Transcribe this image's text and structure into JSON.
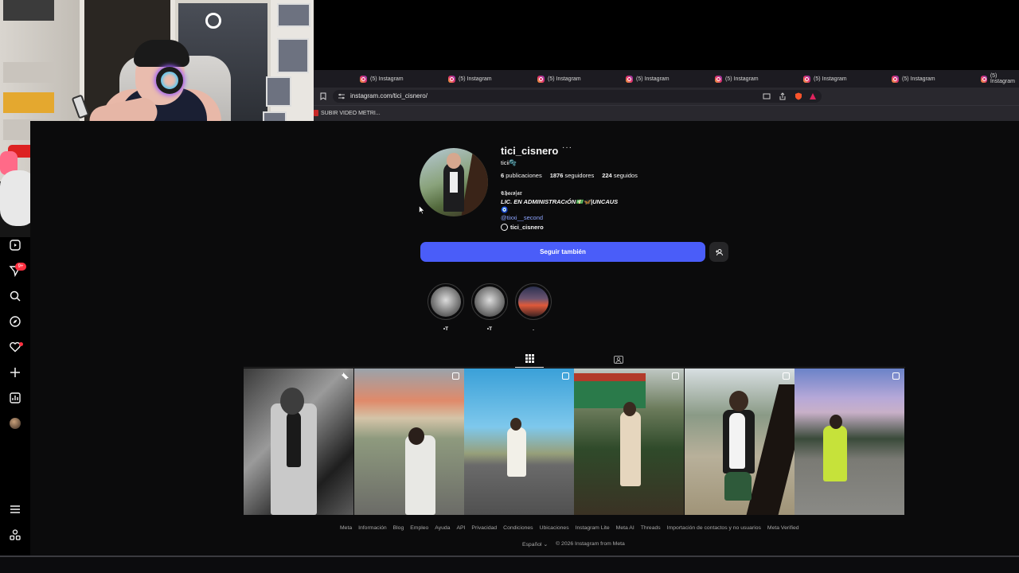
{
  "browser": {
    "tab_title": "(5) Instagram",
    "tab_count": 8,
    "url": "instagram.com/tici_cisnero/",
    "bookmark": "SUBIR VIDEO METRI..."
  },
  "sidebar": {
    "notification_badge": "9+",
    "items": [
      "reels-icon",
      "messages-icon",
      "search-icon",
      "explore-icon",
      "notifications-icon",
      "create-icon",
      "dashboard-icon",
      "profile-avatar",
      "menu-icon",
      "more-icon"
    ]
  },
  "profile": {
    "username": "tici_cisnero",
    "more": "···",
    "fullname": "ticii🫧",
    "posts_count": "6",
    "posts_label": "publicaciones",
    "followers_count": "1876",
    "followers_label": "seguidores",
    "following_count": "224",
    "following_label": "seguidos",
    "bio": [
      "𝕮𝖍𝖆𝖈𝖔|𝖆𝖗",
      "LIC. EN ADMINISTRACıÓN💵🦋|UNCAUS",
      "🧿",
      "@tixxi__second"
    ],
    "threads": "tici_cisnero",
    "follow_button": "Seguir también"
  },
  "highlights": [
    {
      "label": "•T"
    },
    {
      "label": "•T"
    },
    {
      "label": "."
    }
  ],
  "tabs": [
    "posts-grid-tab",
    "tagged-tab"
  ],
  "footer": {
    "links": [
      "Meta",
      "Información",
      "Blog",
      "Empleo",
      "Ayuda",
      "API",
      "Privacidad",
      "Condiciones",
      "Ubicaciones",
      "Instagram Lite",
      "Meta AI",
      "Threads",
      "Importación de contactos y no usuarios",
      "Meta Verified"
    ],
    "language": "Español",
    "copyright": "© 2026 Instagram from Meta"
  },
  "colors": {
    "follow_button": "#4a5df9",
    "background": "#0b0b0c",
    "badge": "#ff3040"
  }
}
